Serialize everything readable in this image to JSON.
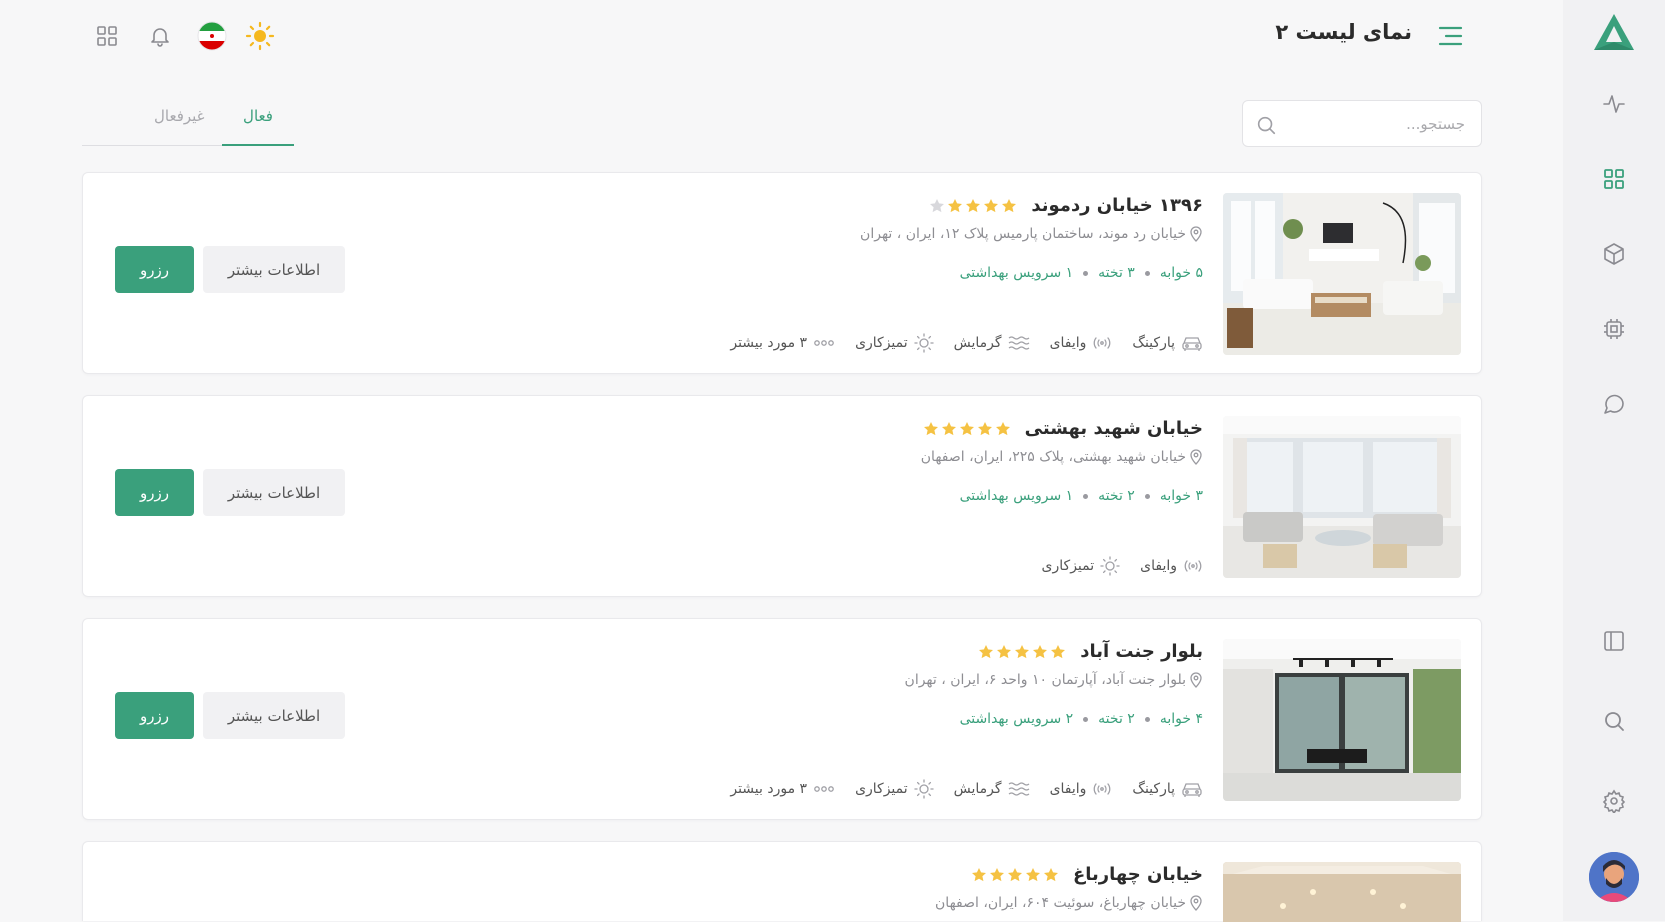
{
  "header": {
    "title": "نمای لیست ۲",
    "icons": [
      "menu-icon",
      "theme-sun-icon",
      "flag-iran-icon",
      "bell-icon",
      "apps-grid-icon"
    ]
  },
  "colors": {
    "accent": "#3aa07c",
    "star": "#f5c243",
    "star_empty": "#d8d8dc",
    "text_muted": "#8d8d92"
  },
  "search": {
    "placeholder": "جستجو..."
  },
  "tabs": [
    {
      "label": "فعال",
      "active": true
    },
    {
      "label": "غیرفعال",
      "active": false
    }
  ],
  "sidebar": {
    "icons": [
      "logo",
      "activity-icon",
      "grid-icon",
      "cube-icon",
      "chip-icon",
      "chat-icon",
      "layout-icon",
      "search-icon",
      "settings-icon",
      "user-avatar"
    ]
  },
  "listings": [
    {
      "title": "۱۳۹۶ خیابان ردموند",
      "rating": 4,
      "address": "خیابان رد موند، ساختمان پارمیس پلاک ۱۲، ایران ، تهران",
      "bedrooms": "۵ خوابه",
      "beds": "۳ تخته",
      "bathrooms": "۱ سرویس بهداشتی",
      "amenities": [
        {
          "label": "پارکینگ",
          "icon": "car-icon"
        },
        {
          "label": "وایفای",
          "icon": "wifi-icon"
        },
        {
          "label": "گرمایش",
          "icon": "heating-icon"
        },
        {
          "label": "تمیزکاری",
          "icon": "sparkle-icon"
        },
        {
          "label": "۳ مورد بیشتر",
          "icon": "more-dots-icon"
        }
      ],
      "more_label": "اطلاعات بیشتر",
      "book_label": "رزرو"
    },
    {
      "title": "خیابان شهید بهشتی",
      "rating": 5,
      "address": "خیابان شهید بهشتی، پلاک ۲۲۵، ایران، اصفهان",
      "bedrooms": "۳ خوابه",
      "beds": "۲ تخته",
      "bathrooms": "۱ سرویس بهداشتی",
      "amenities": [
        {
          "label": "وایفای",
          "icon": "wifi-icon"
        },
        {
          "label": "تمیزکاری",
          "icon": "sparkle-icon"
        }
      ],
      "more_label": "اطلاعات بیشتر",
      "book_label": "رزرو"
    },
    {
      "title": "بلوار جنت آباد",
      "rating": 5,
      "address": "بلوار جنت آباد، آپارتمان ۱۰ واحد ۶، ایران ، تهران",
      "bedrooms": "۴ خوابه",
      "beds": "۲ تخته",
      "bathrooms": "۲ سرویس بهداشتی",
      "amenities": [
        {
          "label": "پارکینگ",
          "icon": "car-icon"
        },
        {
          "label": "وایفای",
          "icon": "wifi-icon"
        },
        {
          "label": "گرمایش",
          "icon": "heating-icon"
        },
        {
          "label": "تمیزکاری",
          "icon": "sparkle-icon"
        },
        {
          "label": "۳ مورد بیشتر",
          "icon": "more-dots-icon"
        }
      ],
      "more_label": "اطلاعات بیشتر",
      "book_label": "رزرو"
    },
    {
      "title": "خیابان چهارباغ",
      "rating": 5,
      "address": "خیابان چهارباغ، سوئیت ۶۰۴، ایران، اصفهان"
    }
  ]
}
